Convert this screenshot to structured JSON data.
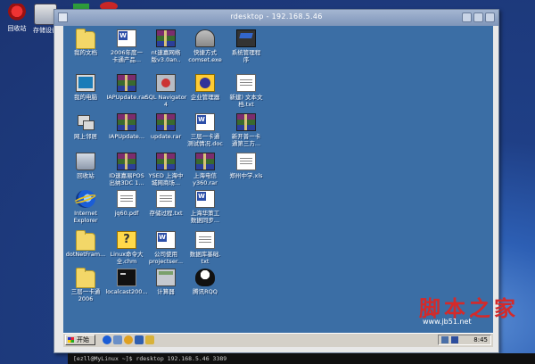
{
  "host_desktop": {
    "icons": [
      {
        "label": "回收站",
        "icon": "trash-icon"
      },
      {
        "label": "存储设备",
        "icon": "storage-device-icon"
      }
    ]
  },
  "window": {
    "title": "rdesktop - 192.168.5.46"
  },
  "remote_desktop": {
    "background_color": "#3b6ea5",
    "icons": [
      {
        "label": "我的文档",
        "icon": "folder-icon",
        "type": "folder"
      },
      {
        "label": "2006年度一\n卡通产品...",
        "icon": "word-document-icon",
        "type": "word"
      },
      {
        "label": "nt速嘉网络\n版v3.0an..",
        "icon": "rar-archive-icon",
        "type": "rar"
      },
      {
        "label": "快捷方式\ncomset.exe",
        "icon": "network-tool-icon",
        "type": "tool"
      },
      {
        "label": "系统管理程\n序",
        "icon": "system-manager-icon",
        "type": "manage"
      },
      {
        "label": "我的电脑",
        "icon": "my-computer-icon",
        "type": "computer"
      },
      {
        "label": "IAPUpdate.rar",
        "icon": "rar-archive-icon",
        "type": "rar"
      },
      {
        "label": "SQL Navigator\n4",
        "icon": "sql-navigator-icon",
        "type": "app"
      },
      {
        "label": "企业管理器",
        "icon": "enterprise-manager-icon",
        "type": "mgr"
      },
      {
        "label": "新建) 文本文\n档.txt",
        "icon": "text-document-icon",
        "type": "doc"
      },
      {
        "label": "网上邻居",
        "icon": "network-neighborhood-icon",
        "type": "network"
      },
      {
        "label": "IAPUpdate...",
        "icon": "rar-archive-icon",
        "type": "rar"
      },
      {
        "label": "update.rar",
        "icon": "rar-archive-icon",
        "type": "rar"
      },
      {
        "label": "三层一卡通\n测试情况.doc",
        "icon": "word-document-icon",
        "type": "word"
      },
      {
        "label": "新开普一卡\n通第三方...",
        "icon": "rar-archive-icon",
        "type": "rar"
      },
      {
        "label": "回收站",
        "icon": "recycle-bin-icon",
        "type": "recycle"
      },
      {
        "label": "ID速嘉易POS\n出纳3DC 1...",
        "icon": "rar-archive-icon",
        "type": "rar"
      },
      {
        "label": "YSED 上海中\n城网商场...",
        "icon": "rar-archive-icon",
        "type": "rar"
      },
      {
        "label": "上海电信\ny360.rar",
        "icon": "rar-archive-icon",
        "type": "rar"
      },
      {
        "label": "郑州中学.xls",
        "icon": "excel-document-icon",
        "type": "doc"
      },
      {
        "label": "Internet\nExplorer",
        "icon": "internet-explorer-icon",
        "type": "ie"
      },
      {
        "label": "jq60.pdf",
        "icon": "pdf-document-icon",
        "type": "doc"
      },
      {
        "label": "存储过程.txt",
        "icon": "text-document-icon",
        "type": "doc"
      },
      {
        "label": "上海华策工\n数据同步...",
        "icon": "word-document-icon",
        "type": "word"
      },
      {
        "label": "dotNetFram...",
        "icon": "folder-icon",
        "type": "folder"
      },
      {
        "label": "Linux命令大\n全.chm",
        "icon": "help-file-icon",
        "type": "help"
      },
      {
        "label": "公司使用\nprojectser...",
        "icon": "word-document-icon",
        "type": "word"
      },
      {
        "label": "数据库基础.\ntxt",
        "icon": "text-document-icon",
        "type": "doc"
      },
      {
        "label": "三层一卡通\n2006",
        "icon": "folder-icon",
        "type": "folder"
      },
      {
        "label": "localcast200...",
        "icon": "terminal-icon",
        "type": "term"
      },
      {
        "label": "计算器",
        "icon": "calculator-icon",
        "type": "calc"
      },
      {
        "label": "腾讯RQQ",
        "icon": "qq-chat-icon",
        "type": "chat"
      }
    ]
  },
  "taskbar": {
    "start_label": "开始",
    "clock": "8:45",
    "quick_launch": [
      "ie-quicklaunch-icon",
      "desktop-quicklaunch-icon",
      "media-quicklaunch-icon",
      "outlook-quicklaunch-icon",
      "explorer-quicklaunch-icon"
    ]
  },
  "terminal": {
    "line": "[ezll@MyLinux ~]$ rdesktop 192.168.5.46 3389"
  },
  "watermark": {
    "text": "脚本之家",
    "url": "www.jb51.net"
  }
}
